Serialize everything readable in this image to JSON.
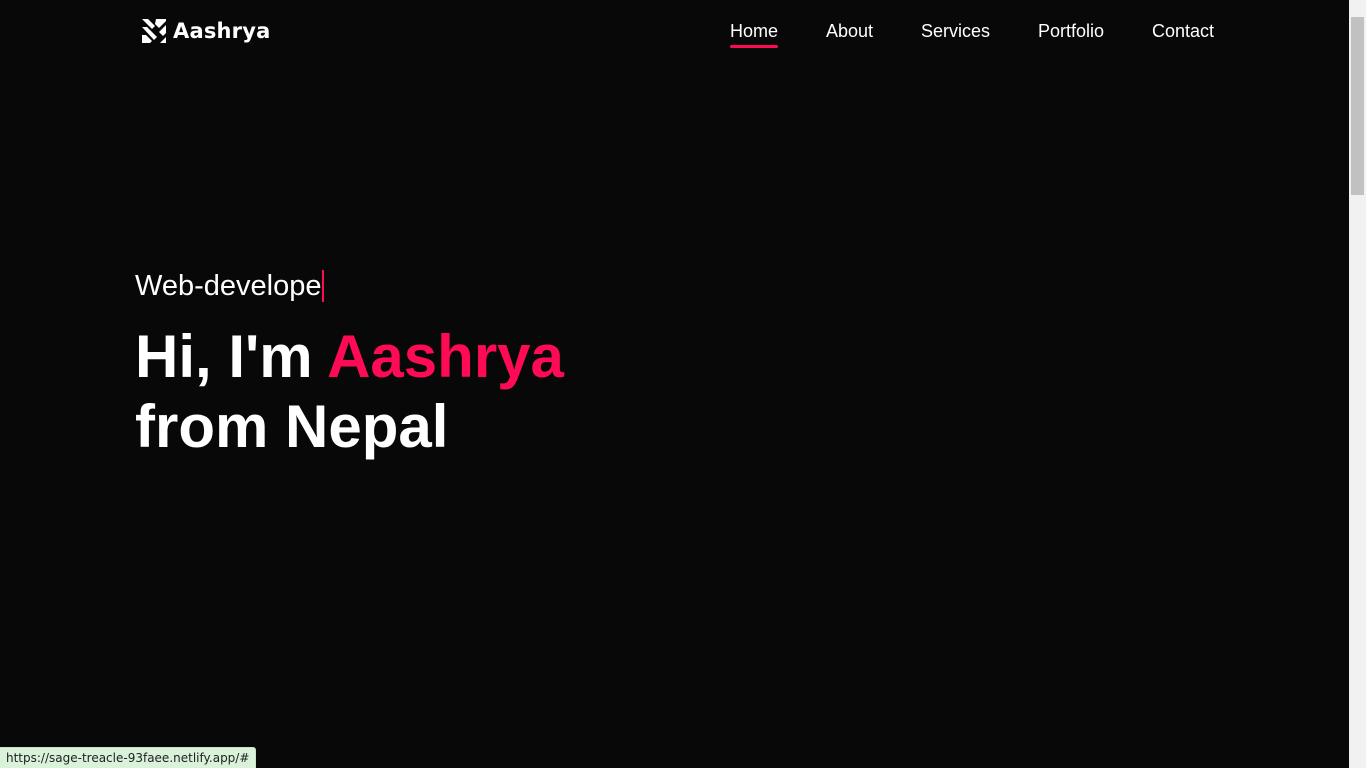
{
  "brand": {
    "name": "Aashrya",
    "logo_icon": "stacked-chevrons-logo"
  },
  "nav": {
    "items": [
      {
        "label": "Home",
        "active": true
      },
      {
        "label": "About",
        "active": false
      },
      {
        "label": "Services",
        "active": false
      },
      {
        "label": "Portfolio",
        "active": false
      },
      {
        "label": "Contact",
        "active": false
      }
    ]
  },
  "hero": {
    "typed_text": "Web-develope",
    "greeting": "Hi, I'm",
    "name": "Aashrya",
    "line2": "from Nepal"
  },
  "status_bar": {
    "url": "https://sage-treacle-93faee.netlify.app/#"
  },
  "colors": {
    "accent": "#ff0b55",
    "background": "#080808",
    "text": "#ffffff"
  }
}
